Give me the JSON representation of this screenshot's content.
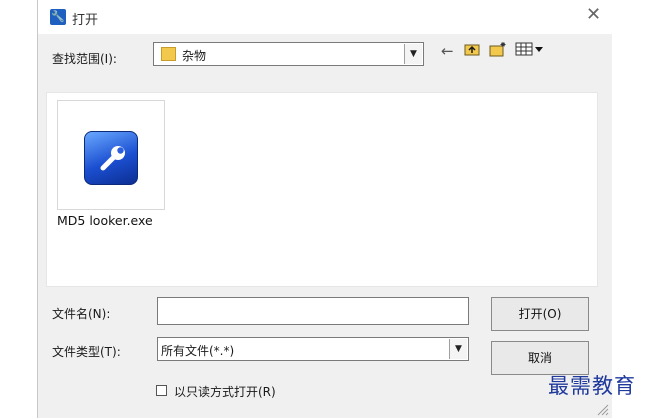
{
  "dialog": {
    "title": "打开",
    "close_glyph": "✕",
    "app_icon": "wrench-icon"
  },
  "lookin": {
    "label": "查找范围(I):",
    "value": "杂物",
    "toolbar_icons": [
      "back-arrow-icon",
      "up-folder-icon",
      "new-folder-icon",
      "view-menu-icon"
    ]
  },
  "files": [
    {
      "name": "MD5 looker.exe",
      "icon": "wrench-app-icon"
    }
  ],
  "filename": {
    "label": "文件名(N):",
    "value": ""
  },
  "filetype": {
    "label": "文件类型(T):",
    "value": "所有文件(*.*)"
  },
  "buttons": {
    "open": "打开(O)",
    "cancel": "取消"
  },
  "readonly": {
    "label": "以只读方式打开(R)",
    "checked": false
  },
  "watermark": "最需教育"
}
